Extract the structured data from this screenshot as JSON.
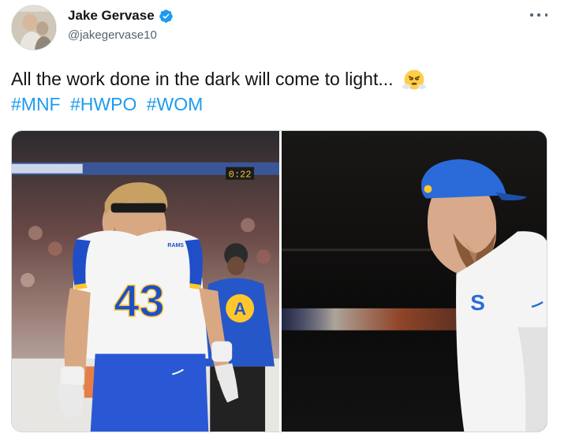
{
  "author": {
    "display_name": "Jake Gervase",
    "handle": "@jakegervase10",
    "verified": true
  },
  "tweet": {
    "text": "All the work done in the dark will come to light...",
    "emoji": "face-with-steam-from-nose",
    "hashtags": [
      "#MNF",
      "#HWPO",
      "#WOM"
    ]
  },
  "media": {
    "left_photo": {
      "jersey_number": "43",
      "jersey_brand": "RAMS",
      "scoreboard_text": "0:22"
    },
    "right_photo": {
      "shirt_text": "S"
    }
  },
  "colors": {
    "link": "#1d9bf0",
    "rams_blue": "#1f4ec8",
    "rams_gold": "#ffc72c",
    "text": "#0f1419",
    "muted": "#536471"
  },
  "icons": {
    "more": "more-icon",
    "verified": "verified-icon"
  }
}
